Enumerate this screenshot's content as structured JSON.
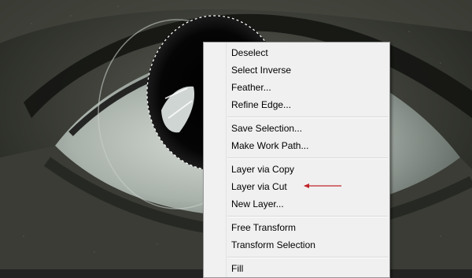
{
  "context_menu": {
    "groups": [
      {
        "items": [
          "Deselect",
          "Select Inverse",
          "Feather...",
          "Refine Edge..."
        ]
      },
      {
        "items": [
          "Save Selection...",
          "Make Work Path..."
        ]
      },
      {
        "items": [
          "Layer via Copy",
          "Layer via Cut",
          "New Layer..."
        ]
      },
      {
        "items": [
          "Free Transform",
          "Transform Selection"
        ]
      },
      {
        "items": [
          "Fill"
        ]
      }
    ]
  },
  "annotation": {
    "color": "#c0262a",
    "points_to": "Layer via Cut"
  },
  "colors": {
    "menu_bg": "#f0f0f0",
    "selection_marquee": "#ffffff"
  }
}
